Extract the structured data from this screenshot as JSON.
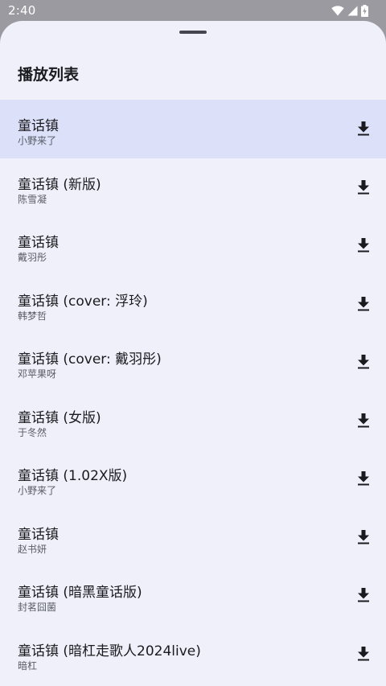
{
  "status_bar": {
    "time": "2:40",
    "icons": [
      "wifi-icon",
      "cellular-signal-icon",
      "battery-charging-icon"
    ]
  },
  "sheet": {
    "title": "播放列表"
  },
  "tracks": [
    {
      "title": "童话镇",
      "artist": "小野来了",
      "active": true
    },
    {
      "title": "童话镇 (新版)",
      "artist": "陈雪凝",
      "active": false
    },
    {
      "title": "童话镇",
      "artist": "戴羽彤",
      "active": false
    },
    {
      "title": "童话镇 (cover: 浮玲)",
      "artist": "韩梦哲",
      "active": false
    },
    {
      "title": "童话镇 (cover: 戴羽彤)",
      "artist": "邓苹果呀",
      "active": false
    },
    {
      "title": "童话镇 (女版)",
      "artist": "于冬然",
      "active": false
    },
    {
      "title": "童话镇 (1.02X版)",
      "artist": "小野来了",
      "active": false
    },
    {
      "title": "童话镇",
      "artist": "赵书妍",
      "active": false
    },
    {
      "title": "童话镇 (暗黑童话版)",
      "artist": "封茗囧菌",
      "active": false
    },
    {
      "title": "童话镇 (暗杠走歌人2024live)",
      "artist": "暗杠",
      "active": false
    }
  ],
  "colors": {
    "sheet_background": "#eff0f9",
    "active_row": "#dce1f9",
    "scrim": "#9a9aa0",
    "text_primary": "#1b1b1f",
    "text_secondary": "#5a5c66"
  }
}
